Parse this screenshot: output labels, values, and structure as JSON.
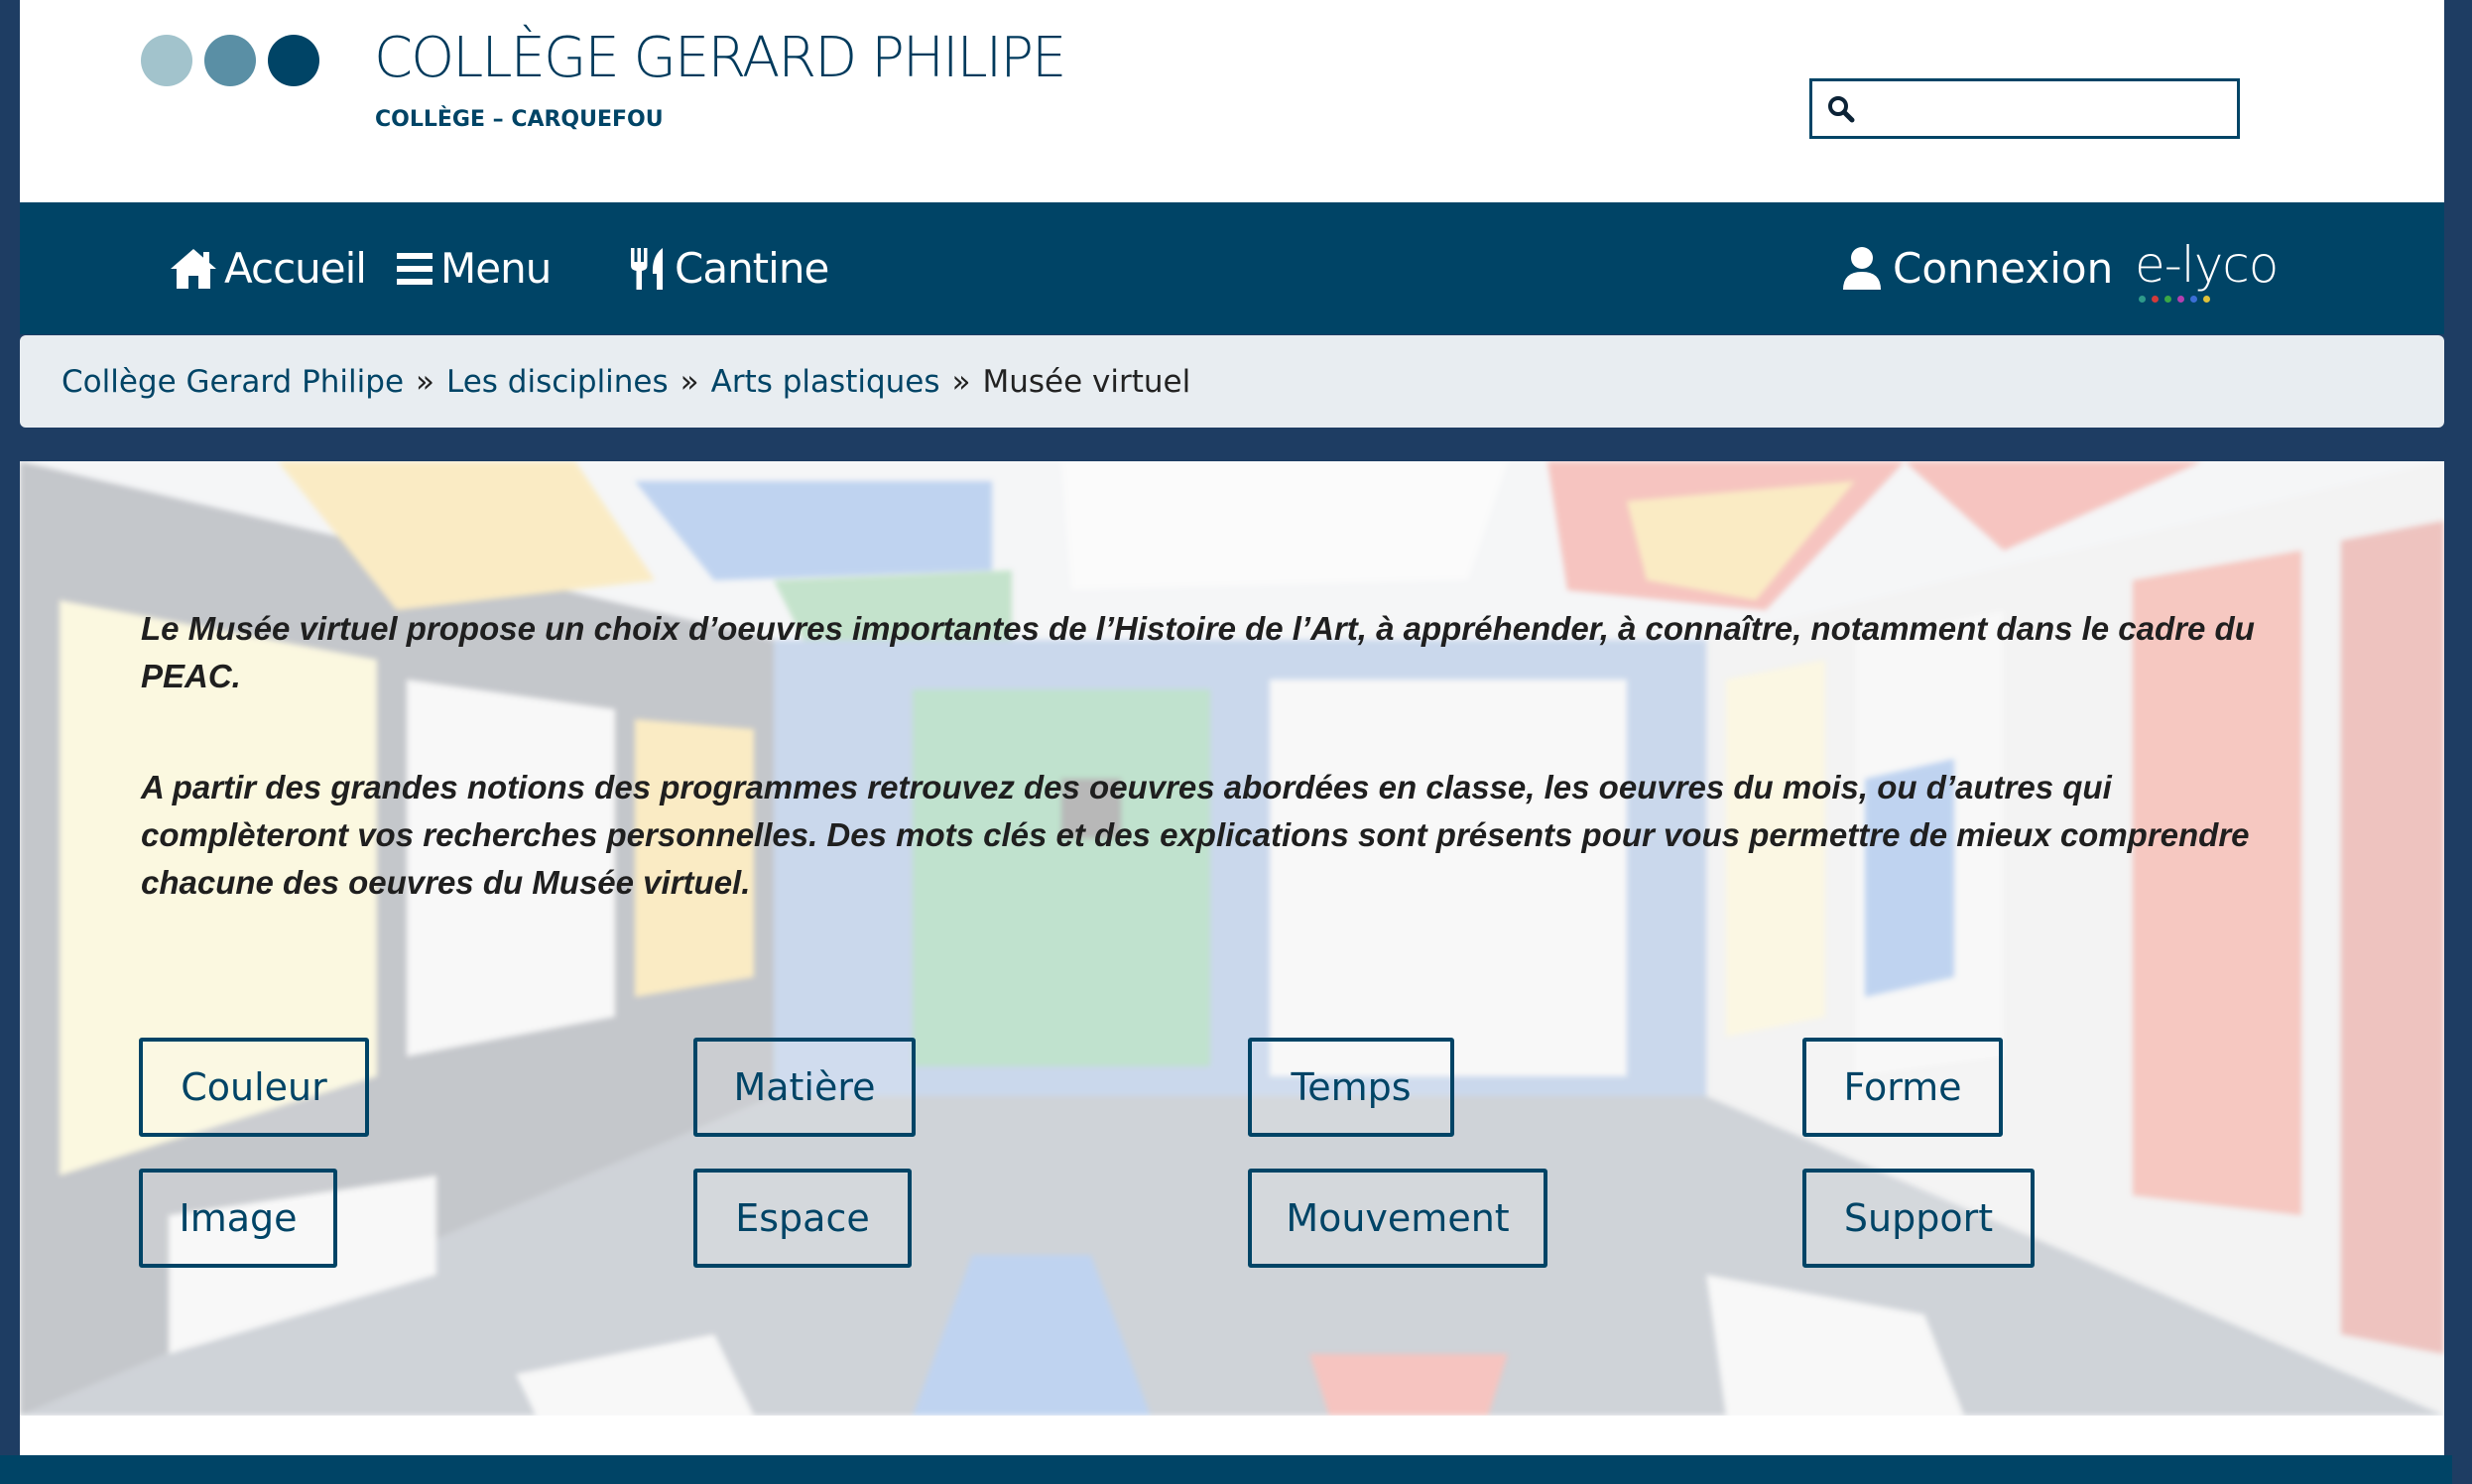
{
  "header": {
    "title": "COLLÈGE GERARD PHILIPE",
    "subtitle": "COLLÈGE – CARQUEFOU",
    "logo_icon": "three-dots-logo",
    "logo_colors": [
      "#a2c3cc",
      "#5a8fa5",
      "#004466"
    ],
    "search": {
      "placeholder": "",
      "value": "",
      "icon": "search-icon"
    }
  },
  "nav": {
    "accueil": "Accueil",
    "menu": "Menu",
    "cantine": "Cantine",
    "connexion": "Connexion",
    "elyco": "e-lyco",
    "icons": [
      "home-icon",
      "hamburger-icon",
      "utensils-icon",
      "user-icon"
    ]
  },
  "breadcrumb": {
    "items": [
      "Collège Gerard Philipe",
      "Les disciplines",
      "Arts plastiques"
    ],
    "separator": "»",
    "current": "Musée virtuel"
  },
  "intro": {
    "p1": "Le Musée virtuel propose un choix d’oeuvres importantes de l’Histoire de l’Art, à appréhender, à connaître, notamment dans le cadre du PEAC.",
    "p2": "A partir des grandes notions des programmes retrouvez des oeuvres abordées en classe, les oeuvres du mois, ou d’autres qui complèteront vos recherches personnelles. Des mots clés et des explications sont présents pour vous permettre de mieux comprendre chacune des oeuvres du Musée virtuel."
  },
  "topics": [
    "Couleur",
    "Matière",
    "Temps",
    "Forme",
    "Image",
    "Espace",
    "Mouvement",
    "Support"
  ],
  "colors": {
    "primary": "#004466",
    "page_background": "#1e3d63",
    "breadcrumb_background": "#e8edf1"
  }
}
